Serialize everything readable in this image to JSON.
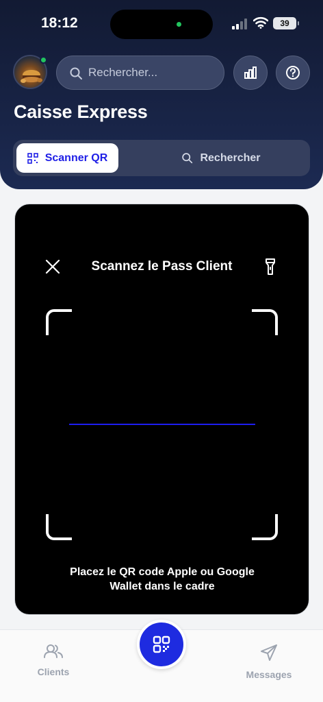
{
  "status_bar": {
    "time": "18:12",
    "battery": "39"
  },
  "header": {
    "search_placeholder": "Rechercher...",
    "title": "Caisse Express"
  },
  "segmented": {
    "scan_label": "Scanner QR",
    "search_label": "Rechercher"
  },
  "scanner": {
    "title": "Scannez le Pass Client",
    "hint_line1": "Placez le QR code Apple ou Google",
    "hint_line2": "Wallet dans le cadre"
  },
  "tabbar": {
    "clients_label": "Clients",
    "messages_label": "Messages"
  },
  "colors": {
    "header_bg": "#152043",
    "accent": "#1e2be0",
    "online": "#22c55e"
  }
}
